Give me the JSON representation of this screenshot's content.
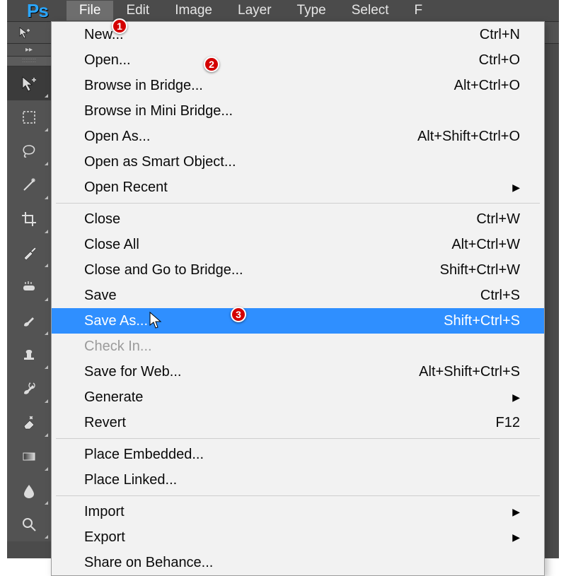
{
  "logo_text": "Ps",
  "menubar": [
    "File",
    "Edit",
    "Image",
    "Layer",
    "Type",
    "Select",
    "F"
  ],
  "active_menu_index": 0,
  "tool_title": "::::::::",
  "tools": [
    "move-tool",
    "marquee-tool",
    "lasso-tool",
    "wand-tool",
    "crop-tool",
    "eyedropper-tool",
    "healing-brush-tool",
    "brush-tool",
    "stamp-tool",
    "history-brush-tool",
    "eraser-tool",
    "gradient-tool",
    "blur-tool",
    "zoom-tool"
  ],
  "active_tool_index": 0,
  "dropdown": [
    {
      "label": "New...",
      "shortcut": "Ctrl+N"
    },
    {
      "label": "Open...",
      "shortcut": "Ctrl+O"
    },
    {
      "label": "Browse in Bridge...",
      "shortcut": "Alt+Ctrl+O"
    },
    {
      "label": "Browse in Mini Bridge..."
    },
    {
      "label": "Open As...",
      "shortcut": "Alt+Shift+Ctrl+O"
    },
    {
      "label": "Open as Smart Object..."
    },
    {
      "label": "Open Recent",
      "submenu": true
    },
    {
      "separator": true
    },
    {
      "label": "Close",
      "shortcut": "Ctrl+W"
    },
    {
      "label": "Close All",
      "shortcut": "Alt+Ctrl+W"
    },
    {
      "label": "Close and Go to Bridge...",
      "shortcut": "Shift+Ctrl+W"
    },
    {
      "label": "Save",
      "shortcut": "Ctrl+S"
    },
    {
      "label": "Save As...",
      "shortcut": "Shift+Ctrl+S",
      "highlight": true
    },
    {
      "label": "Check In...",
      "disabled": true
    },
    {
      "label": "Save for Web...",
      "shortcut": "Alt+Shift+Ctrl+S"
    },
    {
      "label": "Generate",
      "submenu": true
    },
    {
      "label": "Revert",
      "shortcut": "F12"
    },
    {
      "separator": true
    },
    {
      "label": "Place Embedded..."
    },
    {
      "label": "Place Linked..."
    },
    {
      "separator": true
    },
    {
      "label": "Import",
      "submenu": true
    },
    {
      "label": "Export",
      "submenu": true
    },
    {
      "label": "Share on Behance..."
    }
  ],
  "badges": {
    "1": "1",
    "2": "2",
    "3": "3"
  }
}
